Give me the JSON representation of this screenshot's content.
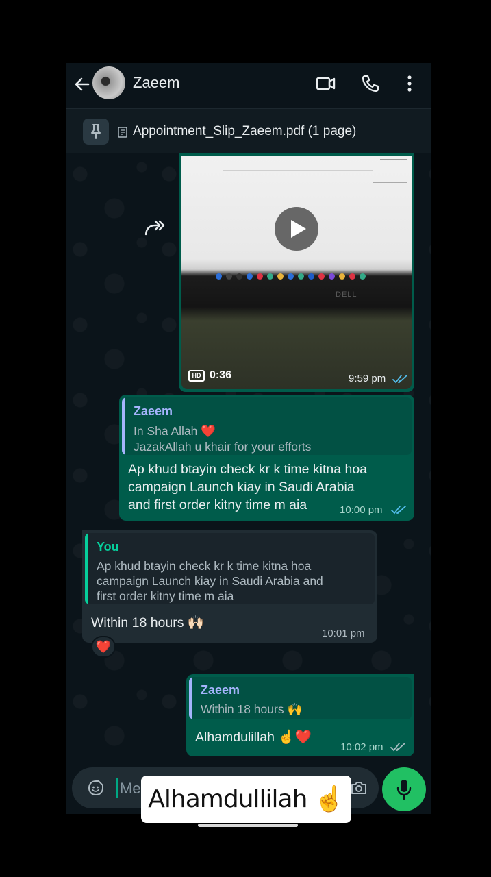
{
  "header": {
    "contact_name": "Zaeem",
    "icons": [
      "back-arrow-icon",
      "video-call-icon",
      "phone-icon",
      "more-vert-icon"
    ]
  },
  "pinned": {
    "text": "Appointment_Slip_Zaeem.pdf (1 page)",
    "icons": [
      "pin-icon",
      "document-icon"
    ]
  },
  "messages": [
    {
      "type": "video",
      "direction": "outgoing",
      "duration": "0:36",
      "quality_badge": "HD",
      "time": "9:59 pm",
      "status": "read"
    },
    {
      "type": "text",
      "direction": "outgoing",
      "quote_name": "Zaeem",
      "quote_line1": "In Sha Allah ❤️",
      "quote_line2": "JazakAllah u khair for your efforts",
      "line1": "Ap khud btayin check kr k time kitna hoa",
      "line2": "campaign Launch kiay in Saudi Arabia",
      "line3": "and first order kitny time m aia",
      "time": "10:00 pm",
      "status": "read"
    },
    {
      "type": "text",
      "direction": "incoming",
      "quote_name": "You",
      "quote_line1": "Ap khud btayin check kr k time kitna hoa",
      "quote_line2": "campaign Launch kiay in Saudi Arabia and",
      "quote_line3": "first order kitny time m aia",
      "text": "Within 18 hours 🙌🏻",
      "time": "10:01 pm",
      "reaction": "❤️"
    },
    {
      "type": "text",
      "direction": "outgoing",
      "quote_name": "Zaeem",
      "quote_line1": "Within 18 hours 🙌",
      "text": "Alhamdulillah ☝️❤️",
      "time": "10:02 pm",
      "status": "delivered"
    }
  ],
  "input": {
    "placeholder": "Mes"
  },
  "overlay": {
    "caption": "Alhamdullilah ☝️"
  },
  "colors": {
    "background": "#0b141a",
    "outgoing_bubble": "#005c4b",
    "incoming_bubble": "#202c33",
    "accent_green": "#21c063",
    "read_ticks": "#53bdeb",
    "quote_name_outgoing": "#a5b4fc",
    "quote_name_incoming": "#06cf9c"
  }
}
